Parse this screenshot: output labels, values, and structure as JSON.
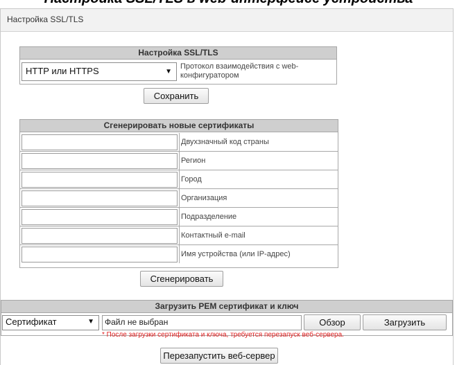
{
  "top_fragment": "Настройка SSL/TLS в web-интерфейсе устройства",
  "page": {
    "title": "Настройка SSL/TLS"
  },
  "ssl": {
    "panel_title": "Настройка SSL/TLS",
    "protocol_value": "HTTP или HTTPS",
    "protocol_label": "Протокол взаимодействия с web-конфигуратором",
    "save_label": "Сохранить"
  },
  "gen": {
    "panel_title": "Сгенерировать новые сертификаты",
    "fields": [
      {
        "label": "Двухзначный код страны",
        "value": ""
      },
      {
        "label": "Регион",
        "value": ""
      },
      {
        "label": "Город",
        "value": ""
      },
      {
        "label": "Организация",
        "value": ""
      },
      {
        "label": "Подразделение",
        "value": ""
      },
      {
        "label": "Контактный e-mail",
        "value": ""
      },
      {
        "label": "Имя устройства (или IP-адрес)",
        "value": ""
      }
    ],
    "generate_label": "Сгенерировать"
  },
  "upload": {
    "panel_title": "Загрузить PEM сертификат и ключ",
    "type_value": "Сертификат",
    "file_status": "Файл не выбран",
    "browse_label": "Обзор",
    "upload_label": "Загрузить",
    "warning": "* После загрузки сертификата и ключа, требуется перезапуск веб-сервера."
  },
  "restart_label": "Перезапустить веб-сервер"
}
